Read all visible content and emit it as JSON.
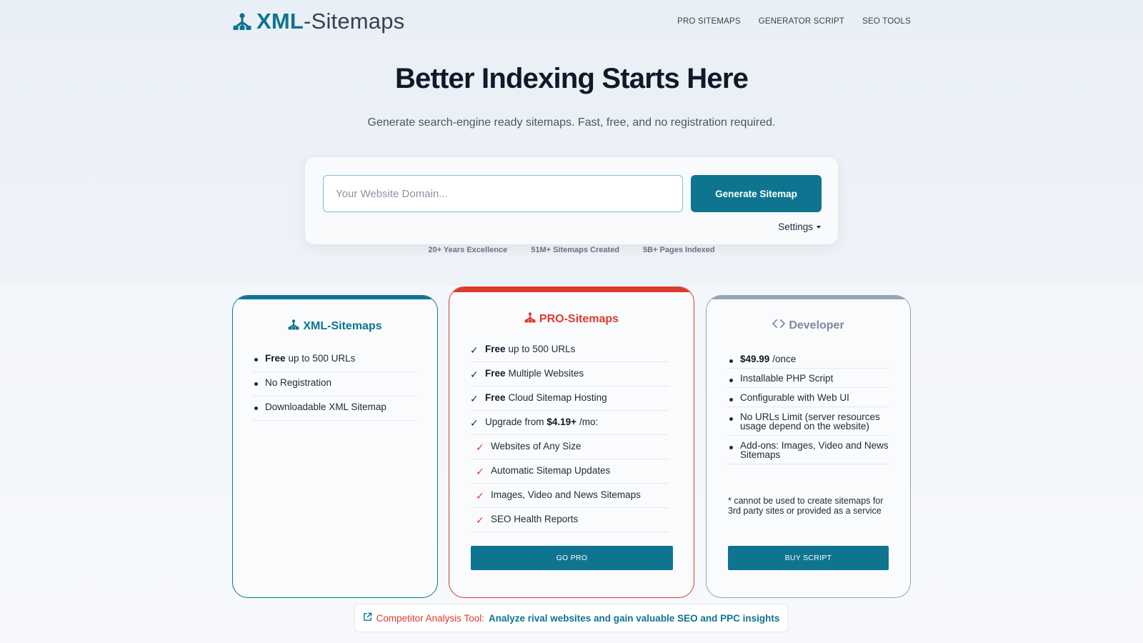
{
  "brand": {
    "logo_bold": "XML",
    "logo_rest": "-Sitemaps",
    "icon": "sitemap-icon",
    "primary_color": "#0e7490",
    "accent_color": "#dc3b2f"
  },
  "nav": {
    "items": [
      "PRO SITEMAPS",
      "GENERATOR SCRIPT",
      "SEO TOOLS"
    ]
  },
  "hero": {
    "title": "Better Indexing Starts Here",
    "subtitle": "Generate search-engine ready sitemaps. Fast, free, and no registration required."
  },
  "generator": {
    "placeholder": "Your Website Domain...",
    "value": "",
    "button": "Generate Sitemap",
    "settings": "Settings"
  },
  "stats": [
    "20+ Years Excellence",
    "51M+ Sitemaps Created",
    "5B+ Pages Indexed"
  ],
  "plans": {
    "free": {
      "title": "XML-Sitemaps",
      "icon": "sitemap-icon",
      "features": [
        {
          "bold": "Free",
          "text": "up to 500 URLs"
        },
        {
          "bold": "",
          "text": "No Registration"
        },
        {
          "bold": "",
          "text": "Downloadable XML Sitemap"
        }
      ]
    },
    "pro": {
      "title": "PRO-Sitemaps",
      "icon": "sitemap-icon",
      "features": [
        {
          "bold": "Free",
          "text": "up to 500 URLs"
        },
        {
          "bold": "Free",
          "text": "Multiple Websites"
        },
        {
          "bold": "Free",
          "text": "Cloud Sitemap Hosting"
        },
        {
          "pre": "Upgrade from",
          "bold": "$4.19+",
          "text": "/mo:"
        }
      ],
      "sub_features": [
        "Websites of Any Size",
        "Automatic Sitemap Updates",
        "Images, Video and News Sitemaps",
        "SEO Health Reports"
      ],
      "button": "GO PRO"
    },
    "developer": {
      "title": "Developer",
      "icon": "code-icon",
      "features": [
        {
          "bold": "$49.99",
          "text": "/once"
        },
        {
          "bold": "",
          "text": "Installable PHP Script"
        },
        {
          "bold": "",
          "text": "Configurable with Web UI"
        },
        {
          "bold": "",
          "text": "No URLs Limit (server resources usage depend on the website)"
        },
        {
          "bold": "",
          "text": "Add-ons: Images, Video and News Sitemaps"
        }
      ],
      "note": "* cannot be used to create sitemaps for 3rd party sites or provided as a service",
      "button": "BUY SCRIPT"
    }
  },
  "promo": {
    "icon": "external-link-icon",
    "label": "Competitor Analysis Tool:",
    "text": "Analyze rival websites and gain valuable SEO and PPC insights"
  }
}
